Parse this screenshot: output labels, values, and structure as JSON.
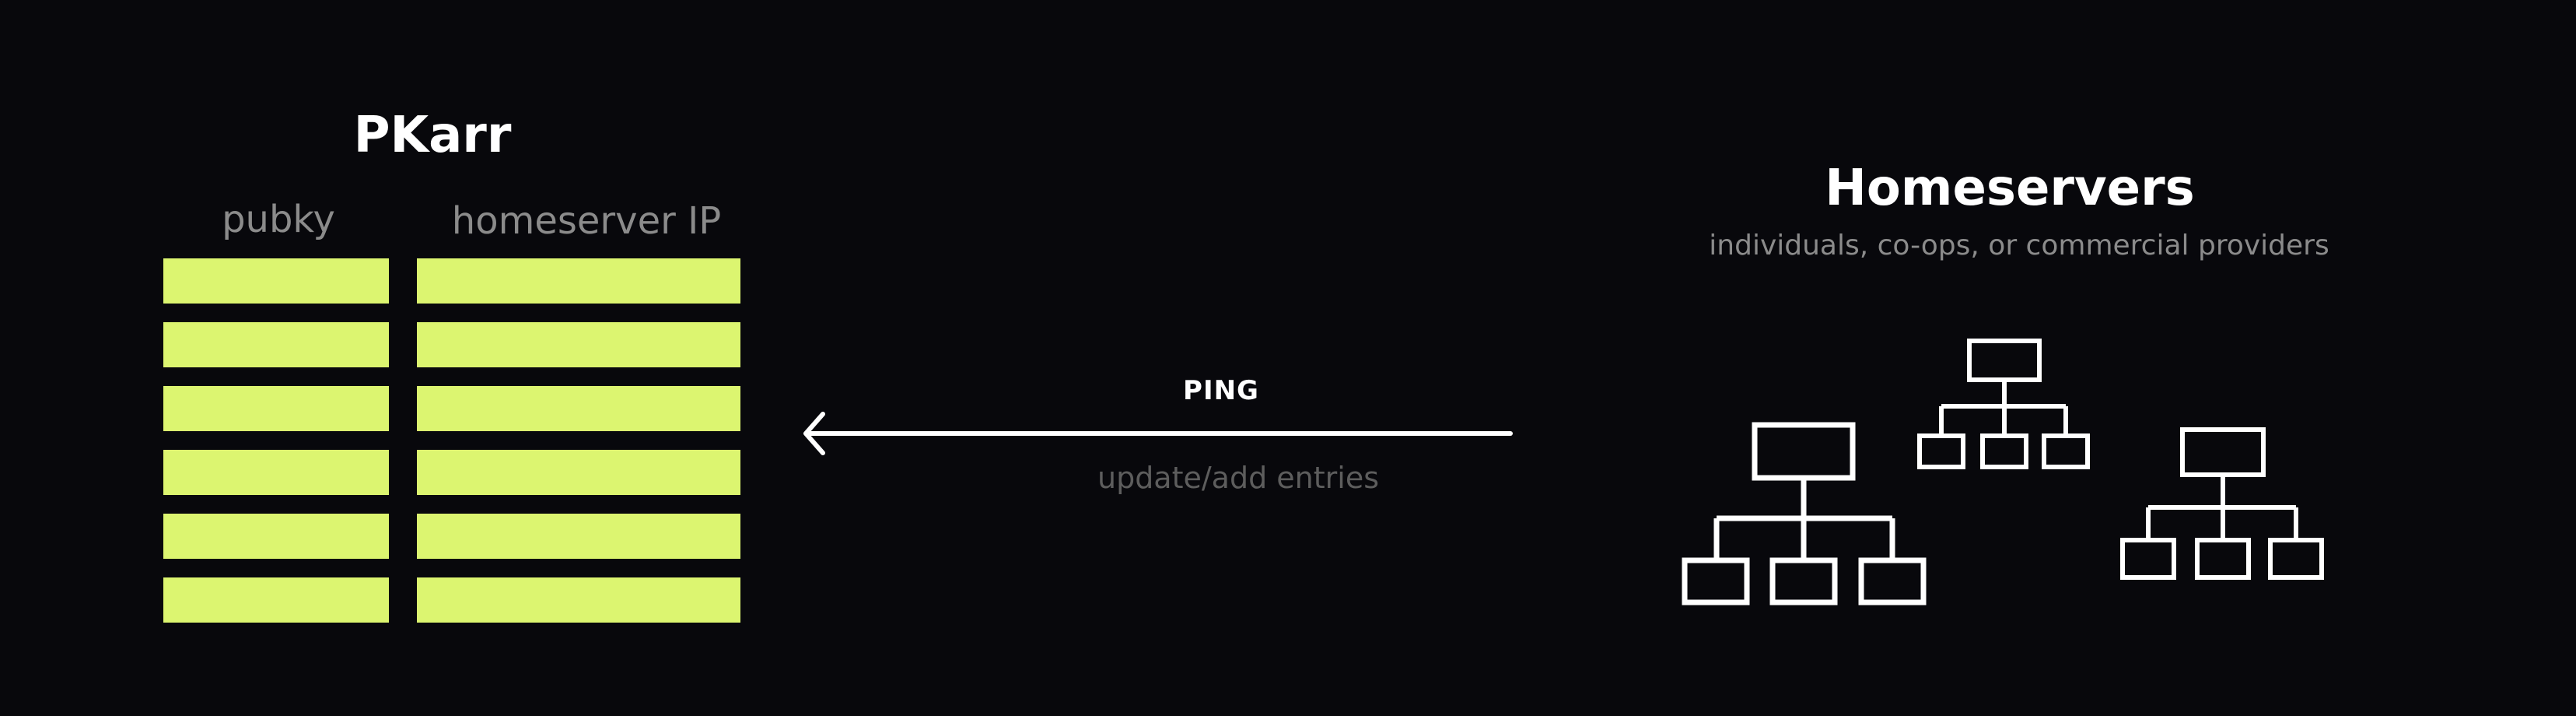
{
  "pkarr": {
    "title": "PKarr",
    "columns": [
      "pubky",
      "homeserver IP"
    ],
    "row_count": 6,
    "cell_color": "#dcf570"
  },
  "arrow": {
    "label": "PING",
    "caption": "update/add entries"
  },
  "homeservers": {
    "title": "Homeservers",
    "subtitle": "individuals, co-ops, or commercial providers",
    "icon": "org-tree-icon",
    "icon_count": 3
  },
  "colors": {
    "background": "#08080c",
    "foreground": "#ffffff",
    "muted_text": "#8b8b8b"
  }
}
